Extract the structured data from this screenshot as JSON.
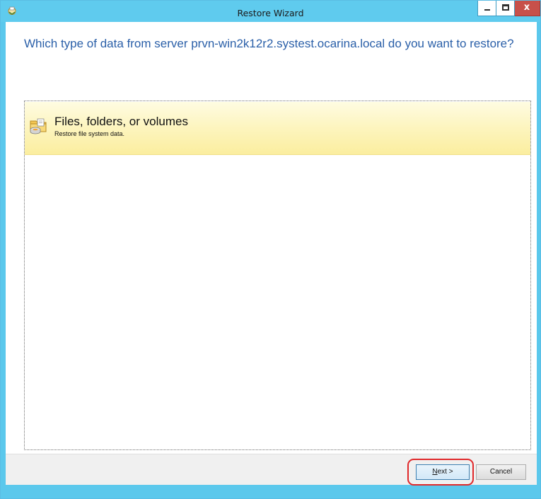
{
  "window": {
    "title": "Restore Wizard",
    "icon": "restore-wizard-app-icon",
    "controls": {
      "minimize": "minimize-icon",
      "maximize": "maximize-icon",
      "close_label": "x"
    }
  },
  "page": {
    "heading": "Which type of data from server prvn-win2k12r2.systest.ocarina.local do you want to restore?"
  },
  "options": [
    {
      "title": "Files, folders, or volumes",
      "description": "Restore file system data.",
      "icon": "folder-disk-icon",
      "selected": true
    }
  ],
  "footer": {
    "next": {
      "underlined_char": "N",
      "rest": "ext >",
      "highlighted": true
    },
    "cancel_label": "Cancel"
  },
  "colors": {
    "titlebar": "#5fcbee",
    "heading": "#2a5fa8",
    "selection": "#fdf5c1",
    "annotation_ring": "#e0282a",
    "close_button": "#c7504a"
  }
}
